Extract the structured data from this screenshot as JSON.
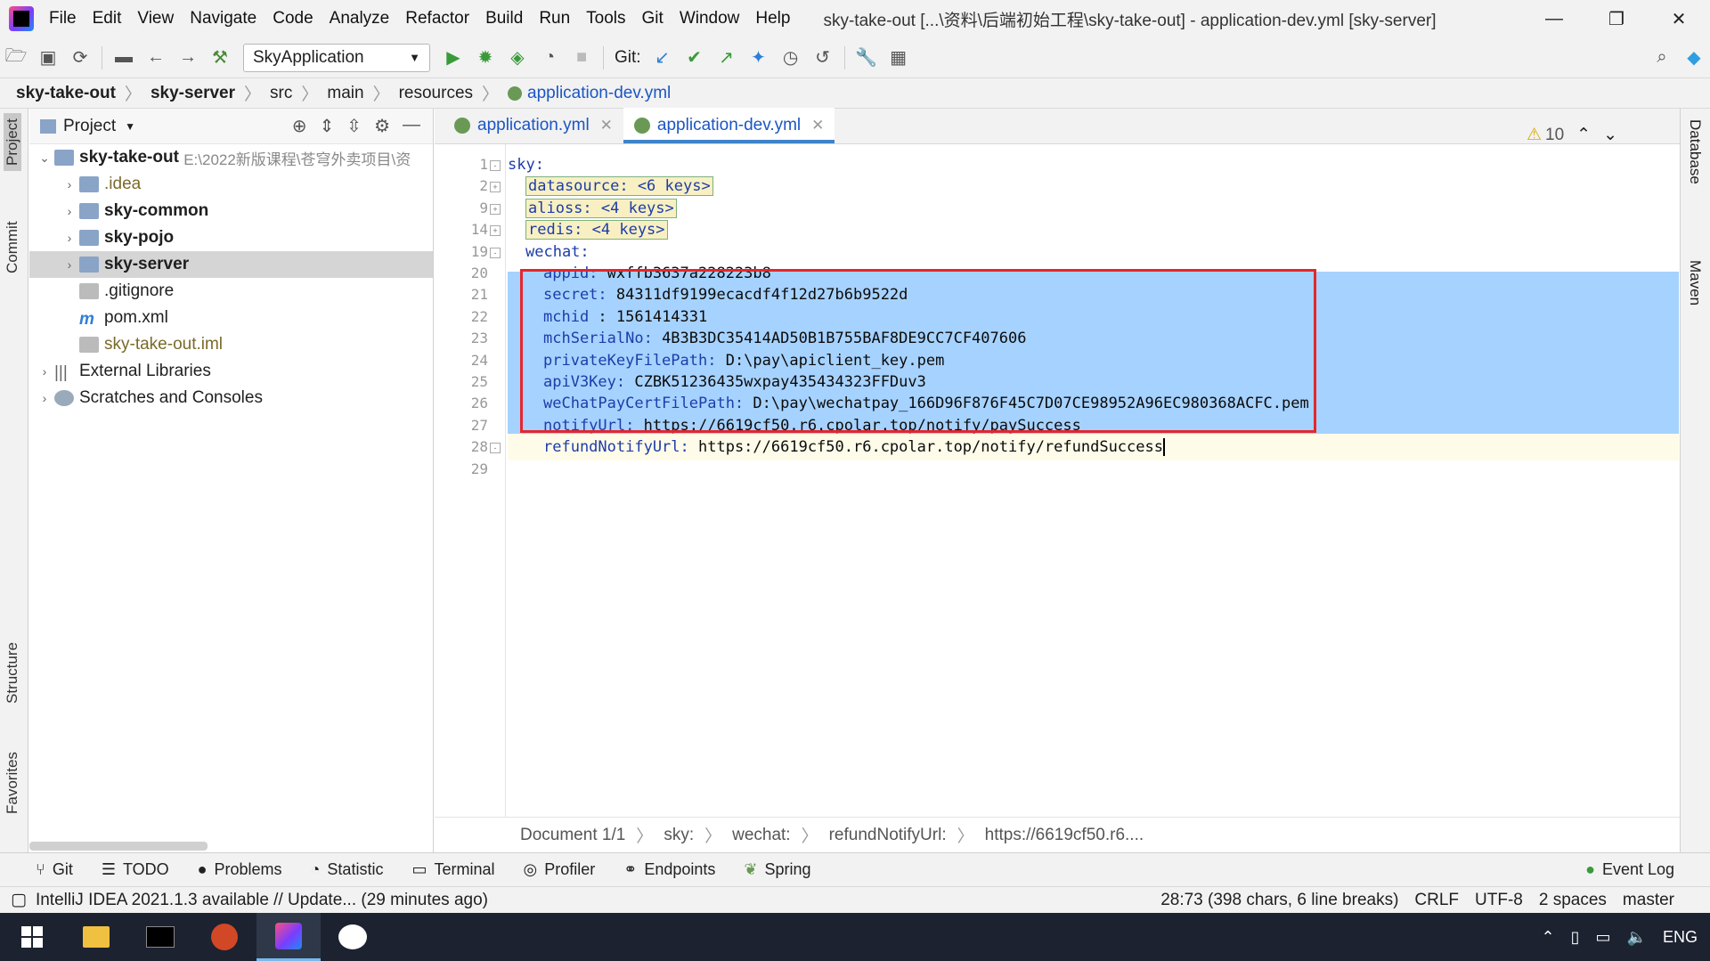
{
  "menubar": {
    "items": [
      "File",
      "Edit",
      "View",
      "Navigate",
      "Code",
      "Analyze",
      "Refactor",
      "Build",
      "Run",
      "Tools",
      "Git",
      "Window",
      "Help"
    ],
    "window_title": "sky-take-out [...\\资料\\后端初始工程\\sky-take-out] - application-dev.yml [sky-server]"
  },
  "toolbar": {
    "run_config": "SkyApplication",
    "git_label": "Git:"
  },
  "breadcrumb": [
    "sky-take-out",
    "sky-server",
    "src",
    "main",
    "resources",
    "application-dev.yml"
  ],
  "left_strip": {
    "project": "Project",
    "commit": "Commit",
    "structure": "Structure",
    "favorites": "Favorites"
  },
  "right_strip": {
    "database": "Database",
    "maven": "Maven"
  },
  "project": {
    "title": "Project",
    "root": "sky-take-out",
    "root_path": "E:\\2022新版课程\\苍穹外卖项目\\资",
    "items": [
      ".idea",
      "sky-common",
      "sky-pojo",
      "sky-server",
      ".gitignore",
      "pom.xml",
      "sky-take-out.iml"
    ],
    "external": "External Libraries",
    "scratches": "Scratches and Consoles"
  },
  "tabs": [
    {
      "label": "application.yml"
    },
    {
      "label": "application-dev.yml"
    }
  ],
  "editor": {
    "warnings": "10",
    "lines": [
      {
        "n": "1",
        "key": "sky:",
        "val": ""
      },
      {
        "n": "2",
        "key": "datasource: <6 keys>",
        "val": ""
      },
      {
        "n": "9",
        "key": "alioss: <4 keys>",
        "val": ""
      },
      {
        "n": "14",
        "key": "redis: <4 keys>",
        "val": ""
      },
      {
        "n": "19",
        "key": "wechat:",
        "val": ""
      },
      {
        "n": "20",
        "key": "appid:",
        "val": " wxffb3637a228223b8"
      },
      {
        "n": "21",
        "key": "secret:",
        "val": " 84311df9199ecacdf4f12d27b6b9522d"
      },
      {
        "n": "22",
        "key": "mchid",
        "val": " : 1561414331"
      },
      {
        "n": "23",
        "key": "mchSerialNo:",
        "val": " 4B3B3DC35414AD50B1B755BAF8DE9CC7CF407606"
      },
      {
        "n": "24",
        "key": "privateKeyFilePath:",
        "val": " D:\\pay\\apiclient_key.pem"
      },
      {
        "n": "25",
        "key": "apiV3Key:",
        "val": " CZBK51236435wxpay435434323FFDuv3"
      },
      {
        "n": "26",
        "key": "weChatPayCertFilePath:",
        "val": " D:\\pay\\wechatpay_166D96F876F45C7D07CE98952A96EC980368ACFC.pem"
      },
      {
        "n": "27",
        "key": "notifyUrl:",
        "val": " https://6619cf50.r6.cpolar.top/notify/paySuccess"
      },
      {
        "n": "28",
        "key": "refundNotifyUrl:",
        "val": " https://6619cf50.r6.cpolar.top/notify/refundSuccess"
      },
      {
        "n": "29",
        "key": "",
        "val": ""
      }
    ]
  },
  "status_crumb": [
    "Document 1/1",
    "sky:",
    "wechat:",
    "refundNotifyUrl:",
    "https://6619cf50.r6...."
  ],
  "bottom_tools": [
    "Git",
    "TODO",
    "Problems",
    "Statistic",
    "Terminal",
    "Profiler",
    "Endpoints",
    "Spring",
    "Event Log"
  ],
  "statusbar": {
    "message": "IntelliJ IDEA 2021.1.3 available // Update... (29 minutes ago)",
    "position": "28:73 (398 chars, 6 line breaks)",
    "line_sep": "CRLF",
    "encoding": "UTF-8",
    "indent": "2 spaces",
    "branch": "master"
  },
  "taskbar": {
    "lang": "ENG"
  },
  "colors": {
    "selection": "#a6d2ff",
    "highlight_box": "#e4262c",
    "key": "#1d3da9"
  }
}
